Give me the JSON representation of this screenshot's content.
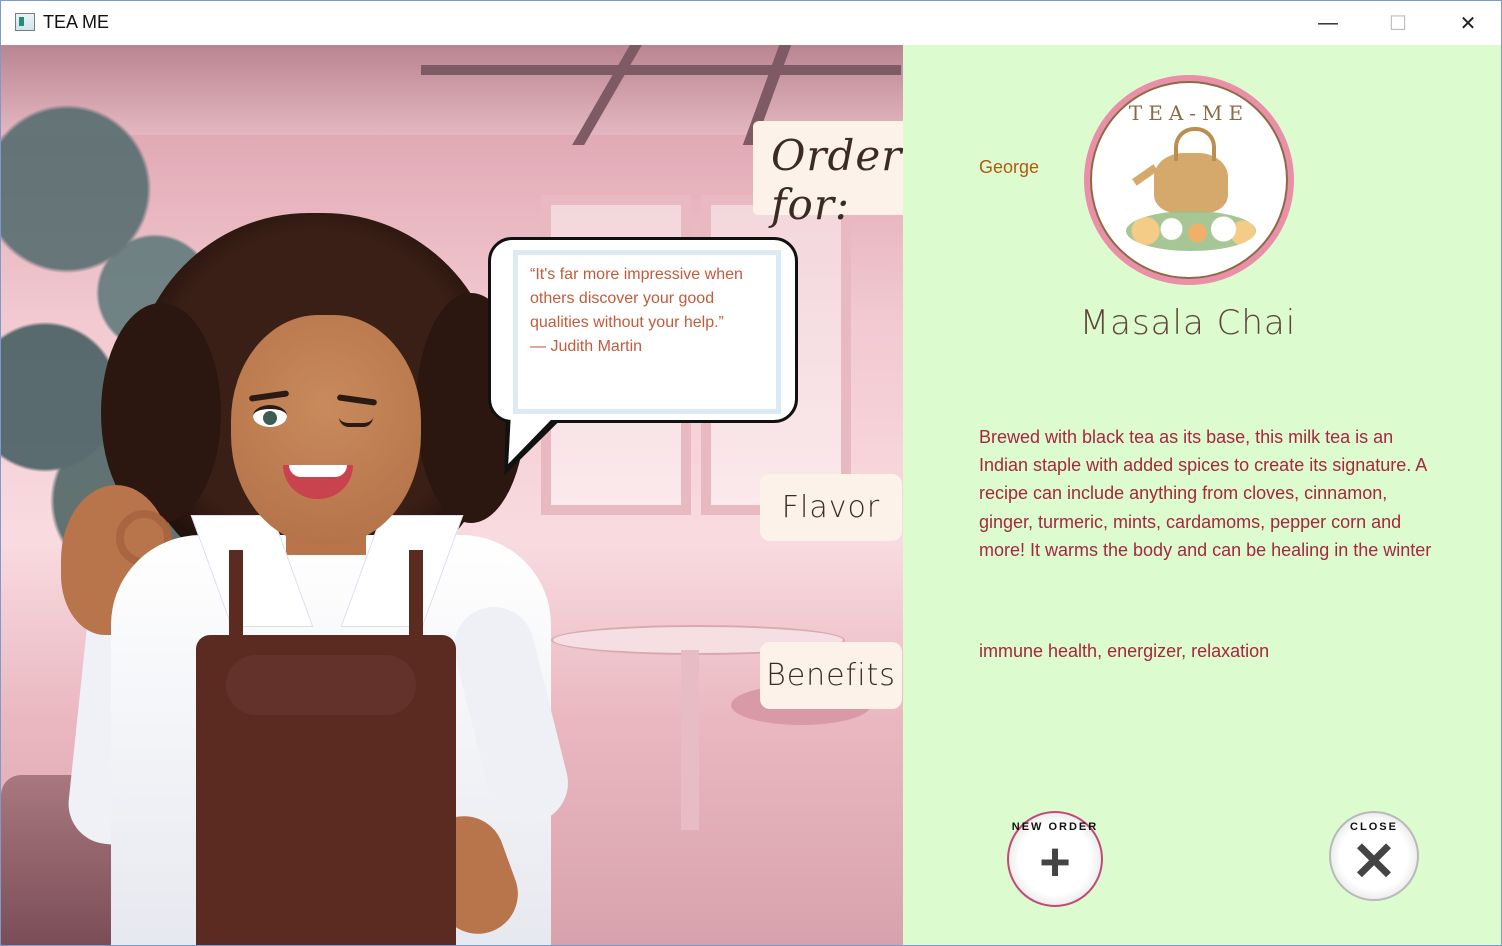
{
  "window": {
    "title": "TEA ME",
    "controls": {
      "minimize": "—",
      "maximize": "☐",
      "close": "✕"
    }
  },
  "scene": {
    "quote": "“It's far more impressive when\nothers discover your good\nqualities without your help.”\n— Judith Martin"
  },
  "order": {
    "label": "Order for:",
    "customer": "George"
  },
  "buttons": {
    "flavor": "Flavor",
    "benefits": "Benefits",
    "new_order": "NEW ORDER",
    "close": "CLOSE"
  },
  "tea": {
    "logo_text": "TEA-ME",
    "name": "Masala Chai",
    "description": "Brewed with black tea as its base, this milk tea is an Indian staple with added spices to create its signature. A recipe can include anything from cloves, cinnamon, ginger, turmeric, mints, cardamoms, pepper corn and more! It warms the body and can be healing in the winter",
    "benefits": "immune health, energizer, relaxation"
  },
  "icons": {
    "new_order": "+",
    "close": "✕"
  },
  "colors": {
    "panel_bg": "#dcfcd0",
    "text_accent": "#a8263f",
    "customer_text": "#b3590e",
    "card_bg": "#fcf2ea"
  }
}
